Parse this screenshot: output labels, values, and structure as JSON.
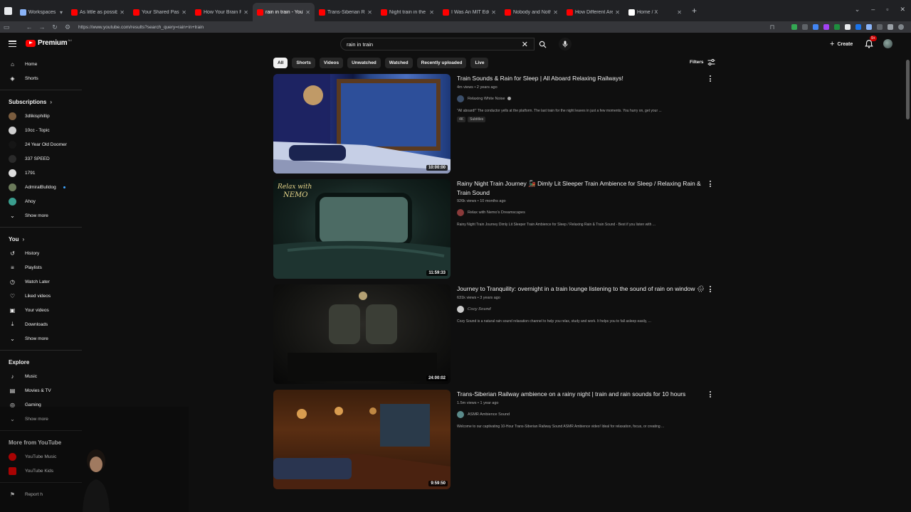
{
  "browser": {
    "workspaces_label": "Workspaces",
    "tabs": [
      {
        "label": "As little as possible w",
        "color": "#ff0000"
      },
      {
        "label": "Your Shared Past With",
        "color": "#ff0000"
      },
      {
        "label": "How Your Brain Picks T",
        "color": "#ff0000"
      },
      {
        "label": "rain in train - YouTube",
        "color": "#ff0000",
        "active": true
      },
      {
        "label": "Trans-Siberian Railway",
        "color": "#ff0000"
      },
      {
        "label": "Night train in the r",
        "color": "#ff0000"
      },
      {
        "label": "I Was An MIT Educate",
        "color": "#ff0000"
      },
      {
        "label": "Nobody and Nothing",
        "color": "#ff0000"
      },
      {
        "label": "How Different Are Our",
        "color": "#ff0000"
      },
      {
        "label": "Home / X",
        "color": "#ffffff"
      }
    ],
    "url": "https://www.youtube.com/results?search_query=rain+in+train"
  },
  "masthead": {
    "logo_text": "Premium",
    "country_code": "AU",
    "search_value": "rain in train",
    "create_label": "Create",
    "notification_count": "9+"
  },
  "sidebar": {
    "main": [
      {
        "label": "Home",
        "icon": "home-icon"
      },
      {
        "label": "Shorts",
        "icon": "shorts-icon"
      }
    ],
    "subscriptions_title": "Subscriptions",
    "subscriptions": [
      {
        "label": "3dlikisphillip",
        "color": "#7a5c3e"
      },
      {
        "label": "10cc - Topic",
        "color": "#cfcfcf"
      },
      {
        "label": "24 Year Old Doomer",
        "color": "#151515"
      },
      {
        "label": "337 SPEED",
        "color": "#2a2a2a"
      },
      {
        "label": "1791",
        "color": "#dddddd"
      },
      {
        "label": "AdmiralBulldog",
        "color": "#6b7a5a",
        "dot": true
      },
      {
        "label": "Ahoy",
        "color": "#3a9e8e"
      }
    ],
    "show_more_1": "Show more",
    "you_title": "You",
    "you_items": [
      {
        "label": "History",
        "icon": "history-icon"
      },
      {
        "label": "Playlists",
        "icon": "playlists-icon"
      },
      {
        "label": "Watch Later",
        "icon": "watch-later-icon"
      },
      {
        "label": "Liked videos",
        "icon": "like-icon"
      },
      {
        "label": "Your videos",
        "icon": "your-videos-icon"
      },
      {
        "label": "Downloads",
        "icon": "download-icon"
      }
    ],
    "show_more_2": "Show more",
    "explore_title": "Explore",
    "explore_items": [
      {
        "label": "Music",
        "icon": "music-icon"
      },
      {
        "label": "Movies & TV",
        "icon": "movies-icon"
      },
      {
        "label": "Gaming",
        "icon": "gaming-icon"
      }
    ],
    "show_more_3": "Show more",
    "more_title": "More from YouTube",
    "more_items": [
      {
        "label": "YouTube Music",
        "color": "#ff0000"
      },
      {
        "label": "YouTube Kids",
        "color": "#ff0000"
      }
    ],
    "report_label": "Report h"
  },
  "chips": [
    "All",
    "Shorts",
    "Videos",
    "Unwatched",
    "Watched",
    "Recently uploaded",
    "Live"
  ],
  "filters_label": "Filters",
  "results": [
    {
      "title": "Train Sounds & Rain for Sleep | All Aboard Relaxing Railways!",
      "meta": "4m views • 2 years ago",
      "channel": "Relaxing White Noise",
      "verified": true,
      "description": "\"All aboard!\" The conductor yells at the platform. The last train for the night leaves in just a few moments. You hurry on, get your ...",
      "tags": [
        "4K",
        "Subtitles"
      ],
      "duration": "10:00:00",
      "channel_color": "#3b4f6b"
    },
    {
      "title": "Rainy Night Train Journey 🚂 Dimly Lit Sleeper Train Ambience for Sleep / Relaxing Rain & Train Sound",
      "meta": "926k views • 10 months ago",
      "channel": "Relax with Nemo's Dreamscapes",
      "description": "Rainy Night Train Journey Dimly Lit Sleeper Train Ambience for Sleep / Relaxing Rain & Train Sound - Best if you listen with ...",
      "duration": "11:59:33",
      "overlay_text_1": "Relax with",
      "overlay_text_2": "NEMO",
      "channel_color": "#8a3a3a"
    },
    {
      "title": "Journey to Tranquility: overnight in a train lounge listening to the sound of rain on window 🌧",
      "meta": "631k views • 3 years ago",
      "channel": "Cozy Sound",
      "description": "Cozy Sound is a natural rain sound relaxation channel to help you relax, study and work. It helps you to fall asleep easily, ...",
      "duration": "24:00:02",
      "channel_color": "#cccccc"
    },
    {
      "title": "Trans-Siberian Railway ambience on a rainy night | train and rain sounds for 10 hours",
      "meta": "1.5m views • 1 year ago",
      "channel": "ASMR Ambience Sound",
      "description": "Welcome to our captivating 10-Hour Trans-Siberian Railway Sound ASMR Ambience video! Ideal for relaxation, focus, or creating ...",
      "duration": "9:59:50",
      "channel_color": "#5a8a8a"
    }
  ]
}
